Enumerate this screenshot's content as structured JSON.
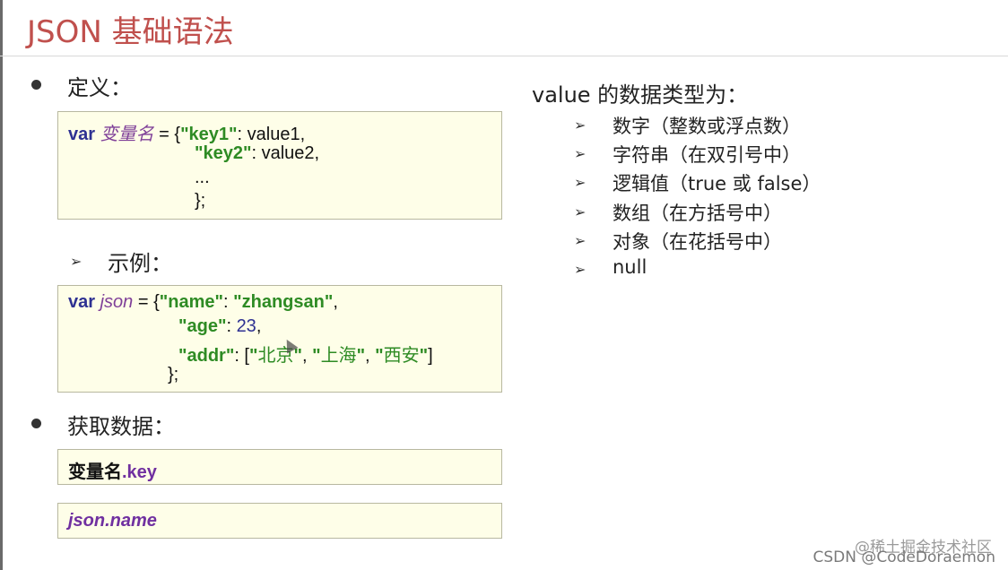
{
  "title": "JSON 基础语法",
  "definition": {
    "label": "定义：",
    "code": {
      "l1_var": "var",
      "l1_name": "变量名",
      "l1_a": " = {",
      "l1_key": "\"key1\"",
      "l1_b": ": value1,",
      "l2_key": "\"key2\"",
      "l2_b": ": value2,",
      "l3": "...",
      "l4": "};"
    }
  },
  "example": {
    "label": "示例：",
    "code": {
      "l1_var": "var",
      "l1_name": "json",
      "l1_a": " = {",
      "l1_key": "\"name\"",
      "l1_colon": ": ",
      "l1_val": "\"zhangsan\"",
      "l1_end": ",",
      "l2_key": "\"age\"",
      "l2_colon": ": ",
      "l2_val": "23",
      "l2_end": ",",
      "l3_key": "\"addr\"",
      "l3_a": ": [",
      "l3_q1": "\"",
      "l3_v1": "北京",
      "l3_q2": "\"",
      "l3_sep1": ", ",
      "l3_q3": "\"",
      "l3_v2": "上海",
      "l3_q4": "\"",
      "l3_sep2": ", ",
      "l3_q5": "\"",
      "l3_v3": "西安",
      "l3_q6": "\"",
      "l3_end": "]",
      "l4": "};"
    }
  },
  "access": {
    "label": "获取数据：",
    "box1_a": "变量名",
    "box1_b": ".key",
    "box2": "json.name"
  },
  "value_types": {
    "heading": "value 的数据类型为：",
    "items": [
      "数字（整数或浮点数）",
      "字符串（在双引号中）",
      "逻辑值（true 或 false）",
      "数组（在方括号中）",
      "对象（在花括号中）",
      "null"
    ]
  },
  "watermark": {
    "line1": "@稀土掘金技术社区",
    "line2": "CSDN @CodeDoraemon"
  },
  "icons": {
    "bullet": "bullet-dot-icon",
    "arrow": "arrow-bullet-icon",
    "cursor": "mouse-cursor-icon"
  }
}
